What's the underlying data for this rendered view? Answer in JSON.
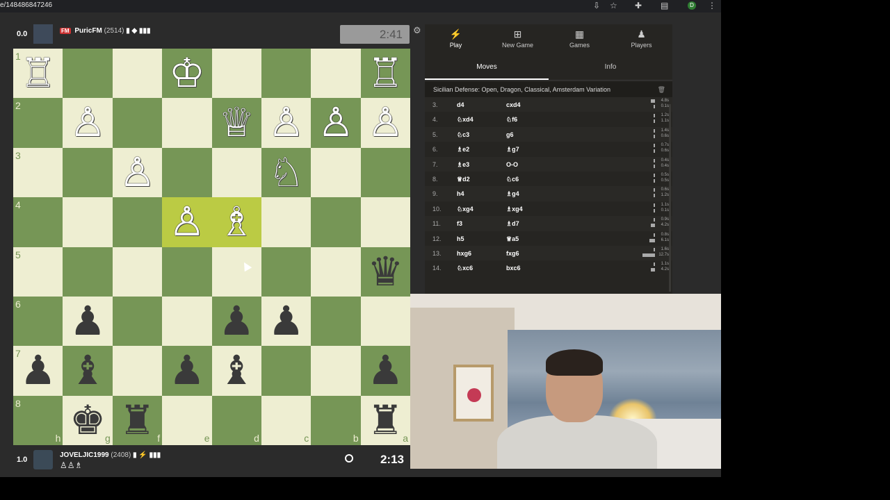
{
  "browser": {
    "url": "e/148486847246",
    "profile_initial": "D",
    "icons": [
      "install-icon",
      "star-icon",
      "extensions-icon",
      "sidebar-icon"
    ]
  },
  "top_player": {
    "score": "0.0",
    "title": "FM",
    "name": "PuricFM",
    "rating": "(2514)",
    "badges": "▮ ◆ ▮▮▮"
  },
  "bottom_player": {
    "score": "1.0",
    "name": "JOVELJIC1999",
    "rating": "(2408)",
    "badges": "▮ ⚡ ▮▮▮",
    "captured": "♙♙♗"
  },
  "clocks": {
    "top": "2:41",
    "bottom": "2:13"
  },
  "board": {
    "orientation": "black",
    "ranks": [
      "1",
      "2",
      "3",
      "4",
      "5",
      "6",
      "7",
      "8"
    ],
    "files": [
      "h",
      "g",
      "f",
      "e",
      "d",
      "c",
      "b",
      "a"
    ],
    "squares": [
      [
        "♖",
        "",
        "",
        "♔",
        "",
        "",
        "",
        "♖"
      ],
      [
        "",
        "♙",
        "",
        "",
        "♕",
        "♙",
        "♙",
        "♙"
      ],
      [
        "",
        "",
        "♙",
        "",
        "",
        "♘",
        "",
        ""
      ],
      [
        "",
        "",
        "",
        "♙",
        "♗",
        "",
        "",
        ""
      ],
      [
        "",
        "",
        "",
        "",
        "",
        "",
        "",
        "♛"
      ],
      [
        "",
        "♟",
        "",
        "",
        "♟",
        "♟",
        "",
        ""
      ],
      [
        "♟",
        "♝",
        "",
        "♟",
        "♝",
        "",
        "",
        "♟"
      ],
      [
        "",
        "♚",
        "♜",
        "",
        "",
        "",
        "",
        "♜"
      ]
    ],
    "colors": [
      [
        "w",
        "",
        "",
        "w",
        "",
        "",
        "",
        "w"
      ],
      [
        "",
        "w",
        "",
        "",
        "w",
        "w",
        "w",
        "w"
      ],
      [
        "",
        "",
        "w",
        "",
        "",
        "w",
        "",
        ""
      ],
      [
        "",
        "",
        "",
        "w",
        "w",
        "",
        "",
        ""
      ],
      [
        "",
        "",
        "",
        "",
        "",
        "",
        "",
        "b"
      ],
      [
        "",
        "b",
        "",
        "",
        "b",
        "b",
        "",
        ""
      ],
      [
        "b",
        "b",
        "",
        "b",
        "b",
        "",
        "",
        "b"
      ],
      [
        "",
        "b",
        "b",
        "",
        "",
        "",
        "",
        "b"
      ]
    ],
    "highlight": [
      "3-3",
      "3-4"
    ]
  },
  "sidebar": {
    "nav": [
      {
        "label": "Play",
        "icon": "lightning-icon",
        "glyph": "⚡"
      },
      {
        "label": "New Game",
        "icon": "plus-icon",
        "glyph": "⊞"
      },
      {
        "label": "Games",
        "icon": "board-icon",
        "glyph": "▦"
      },
      {
        "label": "Players",
        "icon": "players-icon",
        "glyph": "♟"
      }
    ],
    "tabs": [
      "Moves",
      "Info"
    ],
    "opening": "Sicilian Defense: Open, Dragon, Classical, Amsterdam Variation",
    "moves": [
      {
        "n": "3.",
        "w": "d4",
        "b": "cxd4",
        "t": [
          [
            "4.8s",
            3
          ],
          [
            "0.1s",
            1
          ]
        ]
      },
      {
        "n": "4.",
        "w": "♘xd4",
        "b": "♘f6",
        "t": [
          [
            "1.2s",
            1
          ],
          [
            "1.1s",
            1
          ]
        ]
      },
      {
        "n": "5.",
        "w": "♘c3",
        "b": "g6",
        "t": [
          [
            "1.4s",
            1
          ],
          [
            "0.6s",
            1
          ]
        ]
      },
      {
        "n": "6.",
        "w": "♗e2",
        "b": "♗g7",
        "t": [
          [
            "0.7s",
            1
          ],
          [
            "0.6s",
            1
          ]
        ]
      },
      {
        "n": "7.",
        "w": "♗e3",
        "b": "O-O",
        "t": [
          [
            "0.4s",
            1
          ],
          [
            "0.4s",
            1
          ]
        ]
      },
      {
        "n": "8.",
        "w": "♕d2",
        "b": "♘c6",
        "t": [
          [
            "0.5s",
            1
          ],
          [
            "0.5s",
            1
          ]
        ]
      },
      {
        "n": "9.",
        "w": "h4",
        "b": "♗g4",
        "t": [
          [
            "0.6s",
            1
          ],
          [
            "1.2s",
            1
          ]
        ]
      },
      {
        "n": "10.",
        "w": "♘xg4",
        "b": "♗xg4",
        "t": [
          [
            "1.1s",
            1
          ],
          [
            "0.1s",
            1
          ]
        ]
      },
      {
        "n": "11.",
        "w": "f3",
        "b": "♗d7",
        "t": [
          [
            "0.9s",
            1
          ],
          [
            "4.2s",
            3
          ]
        ]
      },
      {
        "n": "12.",
        "w": "h5",
        "b": "♕a5",
        "t": [
          [
            "0.8s",
            1
          ],
          [
            "6.1s",
            4
          ]
        ]
      },
      {
        "n": "13.",
        "w": "hxg6",
        "b": "fxg6",
        "t": [
          [
            "1.6s",
            1
          ],
          [
            "12.7s",
            10
          ]
        ]
      },
      {
        "n": "14.",
        "w": "♘xc6",
        "b": "bxc6",
        "t": [
          [
            "1.1s",
            1
          ],
          [
            "4.2s",
            3
          ]
        ]
      }
    ]
  }
}
